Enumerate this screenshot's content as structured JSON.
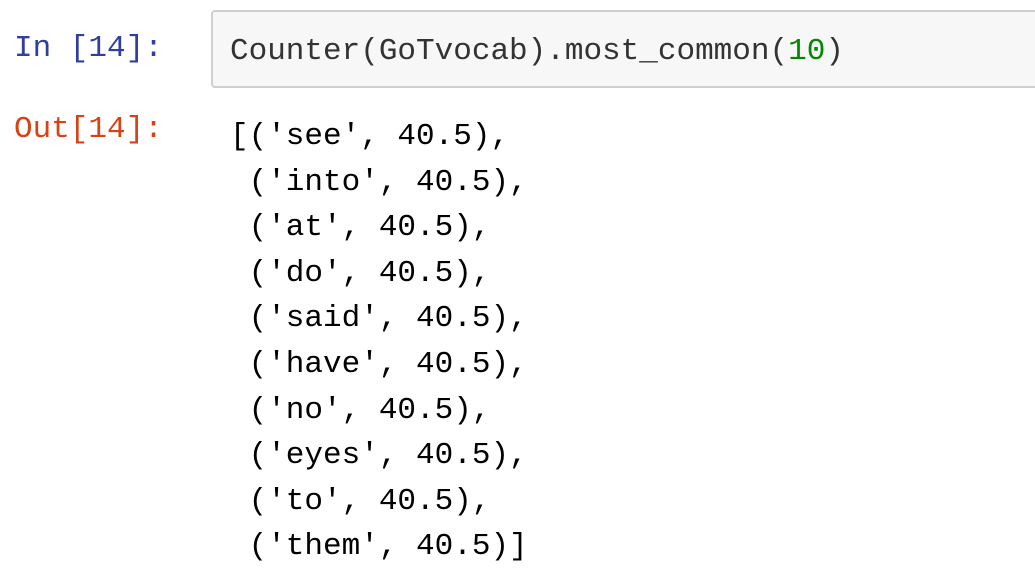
{
  "input_cell": {
    "prompt": "In [14]:",
    "code_prefix": "Counter(GoTvocab).most_common(",
    "code_number": "10",
    "code_suffix": ")"
  },
  "output_cell": {
    "prompt": "Out[14]:",
    "lines": [
      "[('see', 40.5),",
      " ('into', 40.5),",
      " ('at', 40.5),",
      " ('do', 40.5),",
      " ('said', 40.5),",
      " ('have', 40.5),",
      " ('no', 40.5),",
      " ('eyes', 40.5),",
      " ('to', 40.5),",
      " ('them', 40.5)]"
    ]
  },
  "colors": {
    "in_prompt": "#303f9f",
    "out_prompt": "#d84315",
    "code_background": "#f7f7f7",
    "code_border": "#cfcfcf",
    "number_literal": "#008800"
  }
}
